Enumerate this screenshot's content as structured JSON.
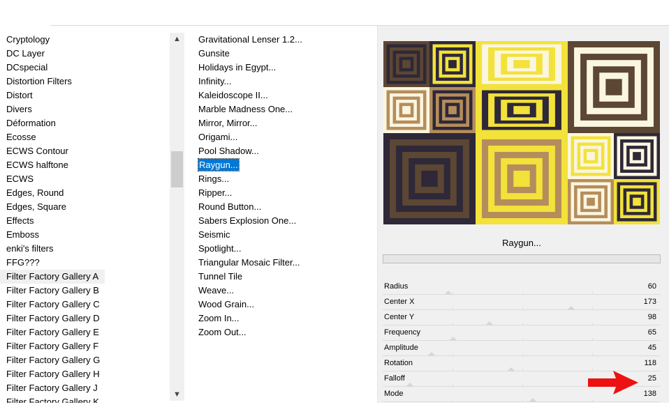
{
  "categories": {
    "items": [
      {
        "label": "Cryptology"
      },
      {
        "label": "DC Layer"
      },
      {
        "label": "DCspecial"
      },
      {
        "label": "Distortion Filters"
      },
      {
        "label": "Distort"
      },
      {
        "label": "Divers"
      },
      {
        "label": "Déformation"
      },
      {
        "label": "Ecosse"
      },
      {
        "label": "ECWS Contour"
      },
      {
        "label": "ECWS halftone"
      },
      {
        "label": "ECWS"
      },
      {
        "label": "Edges, Round"
      },
      {
        "label": "Edges, Square"
      },
      {
        "label": "Effects"
      },
      {
        "label": "Emboss"
      },
      {
        "label": "enki's filters"
      },
      {
        "label": "FFG???"
      },
      {
        "label": "Filter Factory Gallery A",
        "selected": true
      },
      {
        "label": "Filter Factory Gallery B"
      },
      {
        "label": "Filter Factory Gallery C"
      },
      {
        "label": "Filter Factory Gallery D"
      },
      {
        "label": "Filter Factory Gallery E"
      },
      {
        "label": "Filter Factory Gallery F"
      },
      {
        "label": "Filter Factory Gallery G"
      },
      {
        "label": "Filter Factory Gallery H"
      },
      {
        "label": "Filter Factory Gallery J"
      },
      {
        "label": "Filter Factory Gallery K"
      }
    ],
    "scroll_up_icon": "▲",
    "scroll_down_icon": "▼"
  },
  "filters": {
    "items": [
      {
        "label": "Gravitational Lenser 1.2..."
      },
      {
        "label": "Gunsite"
      },
      {
        "label": "Holidays in Egypt..."
      },
      {
        "label": "Infinity..."
      },
      {
        "label": "Kaleidoscope II..."
      },
      {
        "label": "Marble Madness One..."
      },
      {
        "label": "Mirror, Mirror..."
      },
      {
        "label": "Origami..."
      },
      {
        "label": "Pool Shadow..."
      },
      {
        "label": "Raygun...",
        "selected": true
      },
      {
        "label": "Rings..."
      },
      {
        "label": "Ripper..."
      },
      {
        "label": "Round Button..."
      },
      {
        "label": "Sabers Explosion One..."
      },
      {
        "label": "Seismic"
      },
      {
        "label": "Spotlight..."
      },
      {
        "label": "Triangular Mosaic Filter..."
      },
      {
        "label": "Tunnel Tile"
      },
      {
        "label": "Weave..."
      },
      {
        "label": "Wood Grain..."
      },
      {
        "label": "Zoom In..."
      },
      {
        "label": "Zoom Out..."
      }
    ]
  },
  "preview": {
    "colors": {
      "dark": "#2e2838",
      "yellow": "#f2e23a",
      "cream": "#fbf6e0",
      "tan": "#b58d5c",
      "brown": "#5c4634"
    }
  },
  "filter_name": "Raygun...",
  "params": [
    {
      "label": "Radius",
      "value": "60",
      "fraction": 0.235
    },
    {
      "label": "Center X",
      "value": "173",
      "fraction": 0.678
    },
    {
      "label": "Center Y",
      "value": "98",
      "fraction": 0.384
    },
    {
      "label": "Frequency",
      "value": "65",
      "fraction": 0.255
    },
    {
      "label": "Amplitude",
      "value": "45",
      "fraction": 0.176
    },
    {
      "label": "Rotation",
      "value": "118",
      "fraction": 0.463
    },
    {
      "label": "Falloff",
      "value": "25",
      "fraction": 0.098
    },
    {
      "label": "Mode",
      "value": "138",
      "fraction": 0.541
    }
  ],
  "arrow_color": "#ee1111"
}
